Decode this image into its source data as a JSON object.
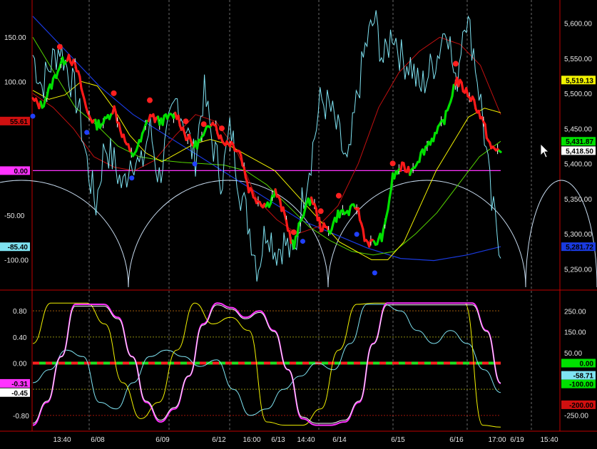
{
  "colors": {
    "background": "#000000",
    "frame": "#c00000",
    "bull": "#00e000",
    "bear": "#ff1a1a",
    "cyan": "#7fe3f2",
    "yellow": "#f2f200",
    "magenta": "#ff33ff",
    "blue_line": "#1a3adf",
    "darkred_line": "#c01010",
    "arc": "#c8dcf0"
  },
  "x_axis": {
    "labels": [
      "13:40",
      "6/08",
      "6/09",
      "6/12",
      "16:00",
      "6/13",
      "14:40",
      "6/14",
      "6/15",
      "6/16",
      "17:00",
      "6/19",
      "15:40"
    ]
  },
  "chart_data": [
    {
      "type": "line",
      "panel": "upper",
      "left_axis": {
        "ticks": [
          "150.00",
          "100.00",
          "0.00",
          "-50.00",
          "-100.00"
        ],
        "range": [
          -130,
          185
        ]
      },
      "right_axis": {
        "ticks": [
          "5,600.00",
          "5,550.00",
          "5,500.00",
          "5,450.00",
          "5,400.00",
          "5,350.00",
          "5,300.00",
          "5,250.00"
        ],
        "range": [
          5225,
          5625
        ]
      },
      "left_tags": [
        {
          "text": "55.61",
          "value": 55.61,
          "color": "#d01010",
          "text_color": "#000000"
        },
        {
          "text": "0.00",
          "value": 0,
          "color": "#ff33ff",
          "text_color": "#000000"
        },
        {
          "text": "-85.40",
          "value": -85.4,
          "color": "#7fe3f2",
          "text_color": "#000000"
        }
      ],
      "right_tags": [
        {
          "text": "5,519.13",
          "value": 5519.13,
          "color": "#f2f200",
          "text_color": "#000000"
        },
        {
          "text": "5,431.87",
          "value": 5431.87,
          "color": "#00e000",
          "text_color": "#000000"
        },
        {
          "text": "5,418.50",
          "value": 5418.5,
          "color": "#ffffff",
          "text_color": "#000000"
        },
        {
          "text": "5,281.72",
          "value": 5281.72,
          "color": "#1a3adf",
          "text_color": "#000000"
        }
      ],
      "price": [
        5490,
        5482,
        5510,
        5540,
        5555,
        5530,
        5475,
        5455,
        5460,
        5480,
        5440,
        5410,
        5432,
        5470,
        5460,
        5465,
        5470,
        5440,
        5425,
        5438,
        5465,
        5432,
        5430,
        5418,
        5365,
        5348,
        5340,
        5360,
        5325,
        5280,
        5330,
        5352,
        5310,
        5305,
        5330,
        5330,
        5340,
        5290,
        5285,
        5300,
        5380,
        5395,
        5390,
        5410,
        5430,
        5445,
        5470,
        5520,
        5505,
        5490,
        5460,
        5420,
        5418
      ],
      "price_color_pattern": "red/green by trend",
      "cycle_osc": [
        130,
        95,
        120,
        140,
        110,
        75,
        10,
        -40,
        30,
        10,
        -20,
        20,
        0,
        50,
        -10,
        40,
        80,
        50,
        10,
        90,
        30,
        -10,
        50,
        -20,
        -60,
        -110,
        -60,
        -90,
        -80,
        -100,
        -30,
        20,
        80,
        70,
        40,
        0,
        80,
        140,
        170,
        120,
        160,
        125,
        120,
        90,
        110,
        130,
        170,
        90,
        180,
        135,
        60,
        -40,
        -85.4
      ],
      "yellow_line": [
        90,
        80,
        85,
        100,
        95,
        70,
        40,
        20,
        10,
        20,
        30,
        35,
        30,
        20,
        10,
        0,
        -20,
        -40,
        -60,
        -80,
        -90,
        -100,
        -100,
        -80,
        -40,
        0,
        30,
        60,
        70,
        65
      ],
      "green_line": [
        5580,
        5530,
        5480,
        5455,
        5425,
        5410,
        5405,
        5402,
        5400,
        5398,
        5390,
        5370,
        5340,
        5310,
        5290,
        5275,
        5270,
        5275,
        5300,
        5330,
        5370,
        5410,
        5431.87
      ],
      "darkred_line": [
        5500,
        5480,
        5450,
        5410,
        5395,
        5390,
        5405,
        5440,
        5470,
        5460,
        5420,
        5350,
        5320,
        5300,
        5310,
        5340,
        5400,
        5480,
        5530,
        5560,
        5580,
        5570,
        5540,
        5470
      ],
      "blue_line": [
        5610,
        5560,
        5510,
        5470,
        5440,
        5410,
        5380,
        5350,
        5320,
        5300,
        5280,
        5265,
        5262,
        5270,
        5281.72
      ],
      "red_dots_approx": 12,
      "blue_dots_approx": 7
    },
    {
      "type": "line",
      "panel": "lower",
      "left_axis": {
        "ticks": [
          "0.80",
          "0.40",
          "0.00",
          "-0.80"
        ],
        "range": [
          -1.02,
          1.02
        ]
      },
      "right_axis": {
        "ticks": [
          "250.00",
          "150.00",
          "50.00",
          "-250.00"
        ],
        "range": [
          -320,
          320
        ]
      },
      "left_tags": [
        {
          "text": "-0.31",
          "value": -0.31,
          "color": "#ff33ff",
          "text_color": "#000000"
        },
        {
          "text": "-0.45",
          "value": -0.45,
          "color": "#ffffff",
          "text_color": "#000000"
        }
      ],
      "right_tags": [
        {
          "text": "0.00",
          "value": 0,
          "color": "#00e000",
          "text_color": "#000000"
        },
        {
          "text": "-58.71",
          "value": -58.71,
          "color": "#7fe3f2",
          "text_color": "#000000"
        },
        {
          "text": "-100.00",
          "value": -100,
          "color": "#00e000",
          "text_color": "#000000"
        },
        {
          "text": "-200.00",
          "value": -200,
          "color": "#d01010",
          "text_color": "#000000"
        }
      ],
      "reference_levels": [
        0.8,
        0.4,
        -0.4,
        -0.8
      ],
      "stoch": [
        -0.95,
        -0.6,
        0.1,
        0.9,
        0.9,
        0.9,
        0.7,
        0.1,
        -0.6,
        -0.9,
        -0.7,
        -0.2,
        0.6,
        0.92,
        0.85,
        0.7,
        0.8,
        0.5,
        -0.1,
        -0.85,
        -0.95,
        -0.95,
        -0.9,
        -0.6,
        0.3,
        0.92,
        0.92,
        0.92,
        0.92,
        0.92,
        0.92,
        0.92,
        0.5,
        -0.31
      ],
      "yellow_osc": [
        0.3,
        0.92,
        0.92,
        0.92,
        0.6,
        -0.3,
        -0.85,
        -0.6,
        0.2,
        0.92,
        0.6,
        0.7,
        0.5,
        -0.9,
        -0.95,
        -0.95,
        -0.7,
        0.2,
        0.9,
        0.92,
        0.92,
        0.92,
        0.92,
        0.92,
        0.92,
        -0.95,
        -0.98
      ],
      "cyan_osc": [
        -0.3,
        -0.1,
        0.2,
        0.1,
        -0.6,
        -0.7,
        -0.3,
        0.1,
        0.2,
        0.1,
        -0.05,
        0.05,
        -0.4,
        -0.8,
        -0.7,
        -0.4,
        -0.2,
        0.0,
        -0.1,
        0.3,
        0.9,
        0.9,
        0.8,
        0.5,
        0.3,
        0.5,
        0.3,
        -0.1,
        -0.45
      ]
    }
  ]
}
